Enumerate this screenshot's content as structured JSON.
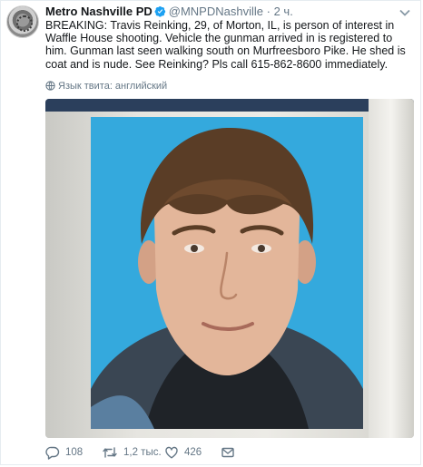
{
  "tweet": {
    "author_name": "Metro Nashville PD",
    "handle": "@MNPDNashville",
    "separator": "·",
    "time": "2 ч.",
    "text": "BREAKING: Travis Reinking, 29, of Morton, IL, is person of interest in Waffle House shooting.  Vehicle the gunman arrived in is registered to him.  Gunman last seen walking south on Murfreesboro Pike.  He shed is coat and is nude.  See Reinking? Pls call 615-862-8600 immediately.",
    "language_label": "Язык твита: английский"
  },
  "actions": {
    "replies": "108",
    "retweets": "1,2 тыс.",
    "likes": "426"
  },
  "icons": {
    "avatar": "avatar-image",
    "verified": "verified-badge-icon",
    "caret": "chevron-down-icon",
    "globe": "globe-icon",
    "reply": "reply-icon",
    "retweet": "retweet-icon",
    "like": "heart-icon",
    "dm": "envelope-icon"
  },
  "colors": {
    "accent": "#1da1f2",
    "secondary_text": "#657786",
    "primary_text": "#14171a",
    "photo_background": "#34a9dd"
  }
}
